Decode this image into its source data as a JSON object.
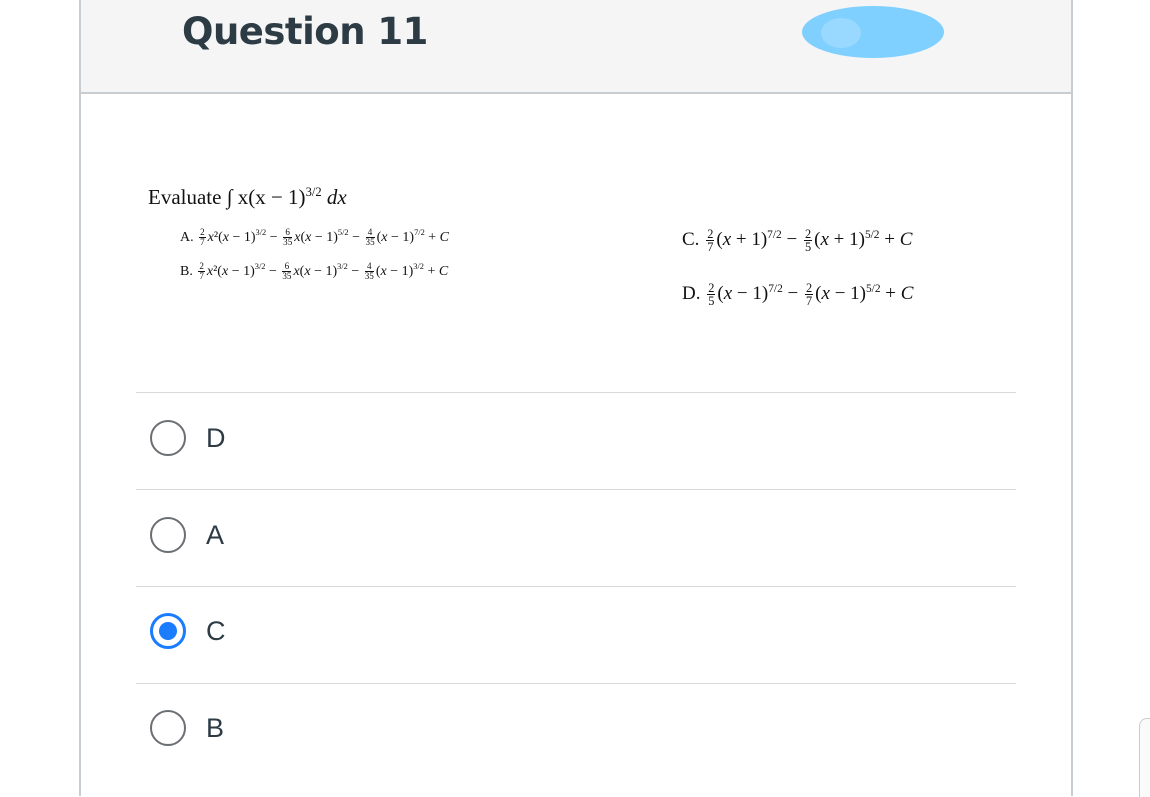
{
  "question": {
    "title": "Question 11",
    "prompt_text": "Evaluate",
    "prompt_expr": "∫ x(x − 1)",
    "prompt_exp": "3/2",
    "prompt_tail": " dx",
    "options": {
      "A": "A. 2/7 x²(x − 1)^(3/2) − 6/35 x(x − 1)^(5/2) − 4/35 (x − 1)^(7/2) + C",
      "B": "B. 2/7 x²(x − 1)^(3/2) − 6/35 x(x − 1)^(3/2) − 4/35 (x − 1)^(3/2) + C",
      "C": "C. 2/7 (x + 1)^(7/2) − 2/5 (x + 1)^(5/2) + C",
      "D": "D. 2/5 (x − 1)^(7/2) − 2/7 (x − 1)^(5/2) + C"
    }
  },
  "answers": [
    {
      "label": "D",
      "selected": false
    },
    {
      "label": "A",
      "selected": false
    },
    {
      "label": "C",
      "selected": true
    },
    {
      "label": "B",
      "selected": false
    }
  ],
  "colors": {
    "accent": "#1a7cff",
    "header_bg": "#f5f5f5",
    "title_text": "#2d3b45",
    "redaction": "#7fd0ff"
  }
}
